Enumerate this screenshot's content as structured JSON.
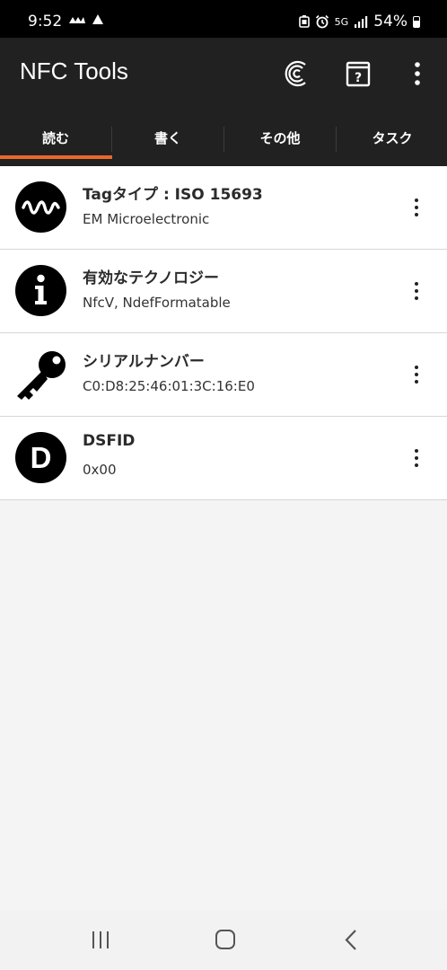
{
  "status_bar": {
    "time": "9:52",
    "left_icons": [
      "weather-icon",
      "notification-icon"
    ],
    "network": "5G",
    "battery": "54%"
  },
  "app": {
    "title": "NFC Tools",
    "toolbar_icons": [
      "nfc-logo-icon",
      "help-book-icon",
      "more-vert-icon"
    ]
  },
  "tabs": [
    {
      "label": "読む",
      "active": true
    },
    {
      "label": "書く",
      "active": false
    },
    {
      "label": "その他",
      "active": false
    },
    {
      "label": "タスク",
      "active": false
    }
  ],
  "accent_color": "#e8692b",
  "records": [
    {
      "icon": "waveform-icon",
      "title": "Tagタイプ : ISO 15693",
      "subtitle": "EM Microelectronic"
    },
    {
      "icon": "info-icon",
      "title": "有効なテクノロジー",
      "subtitle": "NfcV, NdefFormatable"
    },
    {
      "icon": "key-icon",
      "title": "シリアルナンバー",
      "subtitle": "C0:D8:25:46:01:3C:16:E0"
    },
    {
      "icon": "d-letter-icon",
      "title": "DSFID",
      "subtitle": "0x00",
      "icon_letter": "D"
    }
  ],
  "nav_bar": [
    "recent-apps-icon",
    "home-icon",
    "back-icon"
  ]
}
